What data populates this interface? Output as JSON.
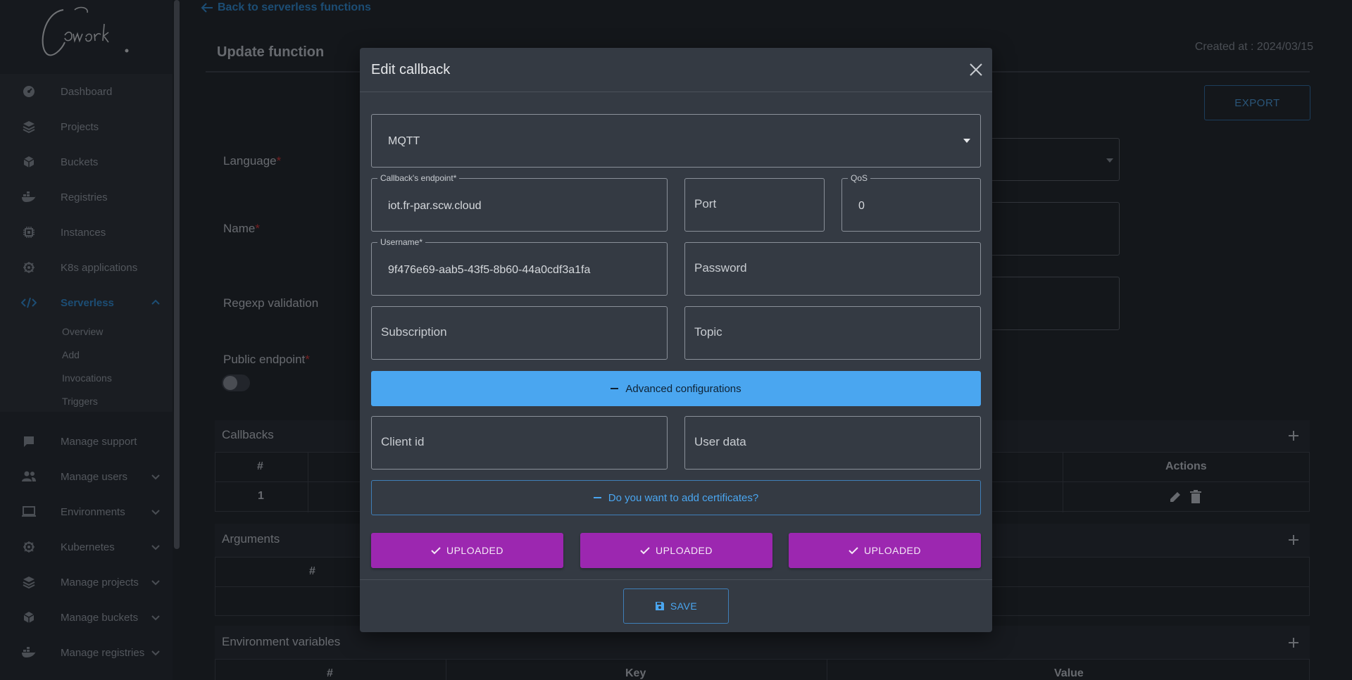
{
  "sidebar": {
    "logo_text": "Comwork",
    "items": [
      {
        "label": "Dashboard",
        "icon": "dashboard-icon"
      },
      {
        "label": "Projects",
        "icon": "layers-icon"
      },
      {
        "label": "Buckets",
        "icon": "box-icon"
      },
      {
        "label": "Registries",
        "icon": "docker-icon"
      },
      {
        "label": "Instances",
        "icon": "chip-icon"
      },
      {
        "label": "K8s applications",
        "icon": "kubernetes-icon"
      },
      {
        "label": "Serverless",
        "icon": "code-icon"
      }
    ],
    "serverless_sub": [
      "Overview",
      "Add",
      "Invocations",
      "Triggers"
    ],
    "admin_items": [
      {
        "label": "Manage support",
        "icon": "chat-icon"
      },
      {
        "label": "Manage users",
        "icon": "users-icon"
      },
      {
        "label": "Environments",
        "icon": "monitor-icon"
      },
      {
        "label": "Kubernetes",
        "icon": "kubernetes-icon"
      },
      {
        "label": "Manage projects",
        "icon": "layers-icon"
      },
      {
        "label": "Manage buckets",
        "icon": "box-icon"
      },
      {
        "label": "Manage registries",
        "icon": "docker-icon"
      }
    ]
  },
  "page": {
    "back_link": "Back to serverless functions",
    "title": "Update function",
    "created_at": "Created at : 2024/03/15",
    "export_label": "EXPORT",
    "fields": {
      "language": "Language",
      "name": "Name",
      "regexp": "Regexp validation",
      "public_endpoint": "Public endpoint"
    },
    "callbacks": {
      "title": "Callbacks",
      "col_hash": "#",
      "col_actions": "Actions",
      "row_number": "1"
    },
    "arguments": {
      "title": "Arguments",
      "col_hash": "#"
    },
    "env_vars": {
      "title": "Environment variables",
      "col_hash": "#",
      "col_key": "Key",
      "col_value": "Value"
    }
  },
  "modal": {
    "title": "Edit callback",
    "type_value": "MQTT",
    "endpoint": {
      "label": "Callback's endpoint*",
      "value": "iot.fr-par.scw.cloud"
    },
    "port": {
      "placeholder": "Port"
    },
    "qos": {
      "label": "QoS",
      "value": "0"
    },
    "username": {
      "label": "Username*",
      "value": "9f476e69-aab5-43f5-8b60-44a0cdf3a1fa"
    },
    "password": {
      "placeholder": "Password"
    },
    "subscription": {
      "placeholder": "Subscription"
    },
    "topic": {
      "placeholder": "Topic"
    },
    "advanced_label": "Advanced configurations",
    "client_id": {
      "placeholder": "Client id"
    },
    "user_data": {
      "placeholder": "User data"
    },
    "certificates_label": "Do you want to add certificates?",
    "uploads": [
      "UPLOADED",
      "UPLOADED",
      "UPLOADED"
    ],
    "save_label": "SAVE"
  },
  "colors": {
    "accent": "#2f8fd8",
    "advanced_button": "#4aa6f0",
    "upload_button": "#9c27b0",
    "required": "#dd3333"
  }
}
